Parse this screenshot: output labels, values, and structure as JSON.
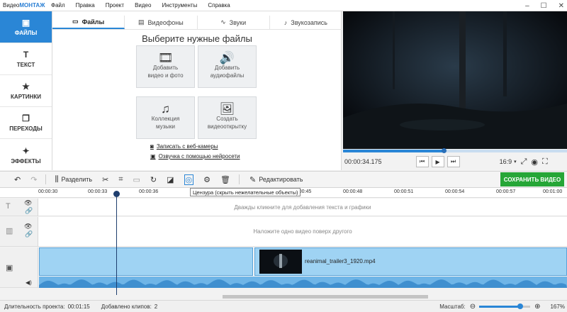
{
  "app": {
    "title_prefix": "Видео",
    "title_brand": "МОНТАЖ",
    "menu": [
      "Файл",
      "Правка",
      "Проект",
      "Видео",
      "Инструменты",
      "Справка"
    ],
    "window_controls": [
      "–",
      "☐",
      "✕"
    ]
  },
  "leftnav": [
    {
      "label": "ФАЙЛЫ",
      "icon": "files-icon",
      "glyph": "▣",
      "active": true
    },
    {
      "label": "ТЕКСТ",
      "icon": "text-icon",
      "glyph": "T",
      "active": false
    },
    {
      "label": "КАРТИНКИ",
      "icon": "star-icon",
      "glyph": "★",
      "active": false
    },
    {
      "label": "ПЕРЕХОДЫ",
      "icon": "transitions-icon",
      "glyph": "❐",
      "active": false
    },
    {
      "label": "ЭФФЕКТЫ",
      "icon": "magic-wand-icon",
      "glyph": "✦",
      "active": false
    }
  ],
  "tabs": [
    {
      "label": "Файлы",
      "glyph": "▭",
      "active": true
    },
    {
      "label": "Видеофоны",
      "glyph": "▤",
      "active": false
    },
    {
      "label": "Звуки",
      "glyph": "∿",
      "active": false
    },
    {
      "label": "Звукозапись",
      "glyph": "♪",
      "active": false
    }
  ],
  "panel": {
    "heading": "Выберите нужные файлы",
    "tiles": [
      {
        "line1": "Добавить",
        "line2": "видео и фото",
        "glyph": "🎞"
      },
      {
        "line1": "Добавить",
        "line2": "аудиофайлы",
        "glyph": "🔊"
      },
      {
        "line1": "Коллекция",
        "line2": "музыки",
        "glyph": "♫"
      },
      {
        "line1": "Создать",
        "line2": "видеооткрытку",
        "glyph": "🖼"
      }
    ],
    "webcam_link": "Записать с веб-камеры",
    "ai_voice_link": "Озвучка с помощью нейросети"
  },
  "player": {
    "timecode": "00:00:34.175",
    "progress": 0.45,
    "aspect": "16:9",
    "zoom_glyph": "⤢",
    "snapshot_glyph": "◉",
    "fullscreen_glyph": "⛶"
  },
  "toolbar": {
    "split_label": "Разделить",
    "edit_label": "Редактировать",
    "save_label": "СОХРАНИТЬ ВИДЕО",
    "tooltip": "Цензура (скрыть нежелательные объекты)"
  },
  "ruler_labels": [
    "00:00:30",
    "00:00:33",
    "00:00:36",
    "00:00:45",
    "00:00:48",
    "00:00:51",
    "00:00:54",
    "00:00:57",
    "00:01:00"
  ],
  "timeline": {
    "text_track_hint": "Дважды кликните для добавления текста и графики",
    "overlay_track_hint": "Наложите одно видео поверх другого",
    "clip_name": "reanimal_trailer3_1920.mp4"
  },
  "status": {
    "duration_label": "Длительность проекта:",
    "duration_value": "00:01:15",
    "clips_label": "Добавлено клипов:",
    "clips_value": "2",
    "scale_label": "Масштаб:",
    "scale_value": "167%",
    "scale_level": 0.8
  },
  "colors": {
    "accent": "#2a86d6",
    "save_button": "#26a637",
    "clip_fill": "#9fd3f3",
    "audio_wave": "#6fb5e7"
  }
}
